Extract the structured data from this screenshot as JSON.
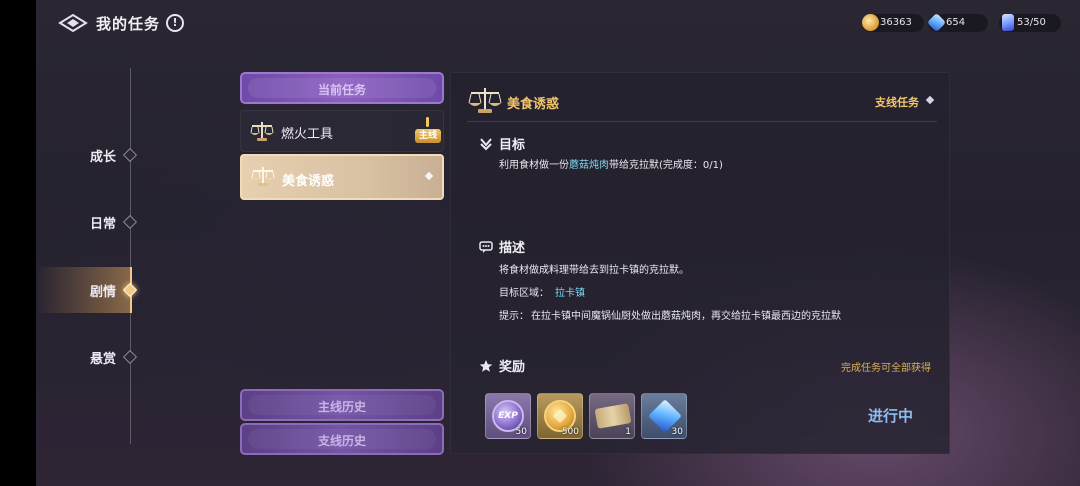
{
  "header": {
    "title": "我的任务",
    "help_icon": "!",
    "currencies": [
      {
        "name": "gold-coin",
        "value": "36363"
      },
      {
        "name": "diamond",
        "value": "654"
      },
      {
        "name": "stamina",
        "value": "53/50"
      }
    ]
  },
  "nav": {
    "items": [
      {
        "label": "成长",
        "active": false
      },
      {
        "label": "日常",
        "active": false
      },
      {
        "label": "剧情",
        "active": true
      },
      {
        "label": "悬赏",
        "active": false
      }
    ]
  },
  "task_list": {
    "current_tab": "当前任务",
    "tasks": [
      {
        "name": "燃火工具",
        "badge": "主线",
        "selected": false
      },
      {
        "name": "美食诱惑",
        "badge": "",
        "selected": true
      }
    ],
    "history_main": "主线历史",
    "history_side": "支线历史"
  },
  "detail": {
    "title": "美食诱惑",
    "type": "支线任务",
    "objective": {
      "title": "目标",
      "prefix": "利用食材做一份",
      "highlight": "蘑菇炖肉",
      "suffix": "带给克拉默(完成度：0/1)"
    },
    "description": {
      "title": "描述",
      "text": "将食材做成料理带给去到拉卡镇的克拉默。",
      "area_label": "目标区域：",
      "area_value": "拉卡镇",
      "hint_label": "提示：",
      "hint_text": "在拉卡镇中间魔锅仙厨处做出蘑菇炖肉，再交给拉卡镇最西边的克拉默"
    },
    "rewards": {
      "title": "奖励",
      "note": "完成任务可全部获得",
      "items": [
        {
          "name": "exp",
          "label": "EXP",
          "qty": "50"
        },
        {
          "name": "gold-coin",
          "qty": "500"
        },
        {
          "name": "scroll",
          "qty": "1"
        },
        {
          "name": "diamond",
          "qty": "30"
        }
      ]
    },
    "status": "进行中"
  },
  "colors": {
    "accent_gold": "#f3c56a",
    "highlight_cyan": "#7fd6f2",
    "status_blue": "#8fbdf0",
    "tab_purple": "#8b5fc0"
  }
}
